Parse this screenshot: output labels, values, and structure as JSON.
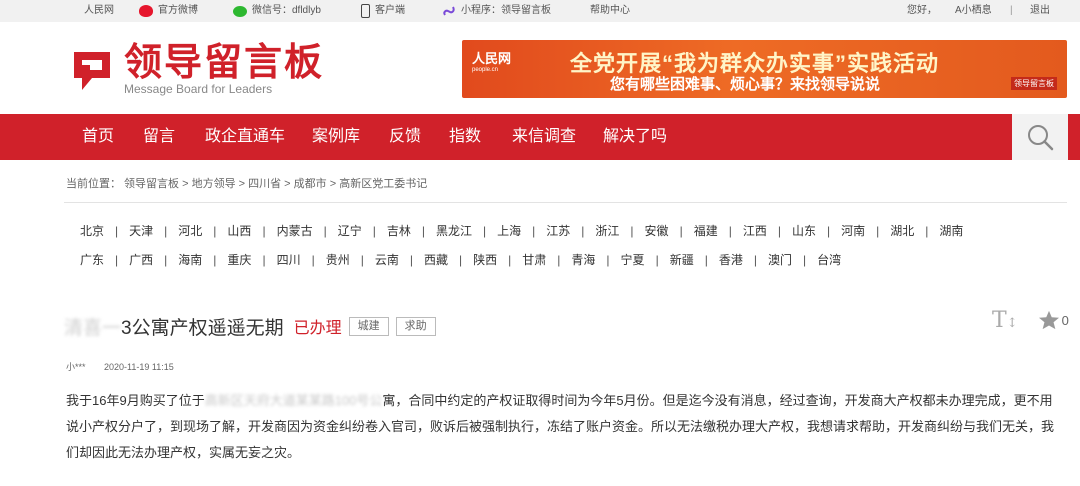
{
  "topbar": {
    "items": [
      "人民网",
      "官方微博",
      "微信号：dfldlyb",
      "客户端",
      "小程序：领导留言板",
      "帮助中心"
    ],
    "greeting": "您好，",
    "user": "A小栖息",
    "divider": "|",
    "logout": "退出"
  },
  "header": {
    "logo_cn": "领导留言板",
    "logo_en": "Message Board for Leaders",
    "banner_brand": "人民网",
    "banner_brand_sub": "people.cn",
    "banner_line1": "全党开展“我为群众办实事”实践活动",
    "banner_line2": "您有哪些困难事、烦心事？来找领导说说",
    "banner_mini": "领导留言板"
  },
  "nav": {
    "items": [
      "首页",
      "留言",
      "政企直通车",
      "案例库",
      "反馈",
      "指数",
      "来信调查",
      "解决了吗"
    ]
  },
  "breadcrumb": "当前位置： 领导留言板 > 地方领导 > 四川省 > 成都市 > 高新区党工委书记",
  "provinces": {
    "row1": [
      "北京",
      "天津",
      "河北",
      "山西",
      "内蒙古",
      "辽宁",
      "吉林",
      "黑龙江",
      "上海",
      "江苏",
      "浙江",
      "安徽",
      "福建",
      "江西",
      "山东",
      "河南",
      "湖北",
      "湖南"
    ],
    "row2": [
      "广东",
      "广西",
      "海南",
      "重庆",
      "四川",
      "贵州",
      "云南",
      "西藏",
      "陕西",
      "甘肃",
      "青海",
      "宁夏",
      "新疆",
      "香港",
      "澳门",
      "台湾"
    ]
  },
  "message": {
    "title_blur": "清喜一",
    "title_rest": "3公寓产权遥遥无期",
    "status": "已办理",
    "tags": [
      "城建",
      "求助"
    ],
    "star_count": "0",
    "author": "小***",
    "time": "2020-11-19 11:15",
    "body_pre": "我于16年9月购买了位于",
    "body_blur": "高新区天府大道某某路100号公",
    "body_post": "寓，合同中约定的产权证取得时间为今年5月份。但是迄今没有消息，经过查询，开发商大产权都未办理完成，更不用说小产权分户了，到现场了解，开发商因为资金纠纷卷入官司，败诉后被强制执行，冻结了账户资金。所以无法缴税办理大产权，我想请求帮助，开发商纠纷与我们无关，我们却因此无法办理产权，实属无妄之灾。"
  },
  "colors": {
    "brand_red": "#d0212a",
    "banner_orange": "#e8561f"
  }
}
